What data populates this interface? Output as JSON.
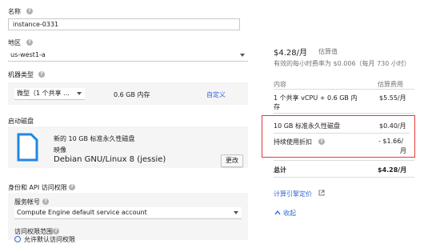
{
  "form": {
    "name_label": "名称",
    "name_value": "instance-0331",
    "zone_label": "地区",
    "zone_value": "us-west1-a",
    "machine_type_label": "机器类型",
    "machine_type_value": "微型（1 个共享 ...",
    "memory_text": "0.6 GB 内存",
    "customize_link": "自定义",
    "boot_disk_label": "启动磁盘",
    "boot_disk_title": "新的 10 GB 标准永久性磁盘",
    "boot_disk_image_label": "映像",
    "boot_disk_image": "Debian GNU/Linux 8 (jessie)",
    "change_button": "更改",
    "identity_label": "身份和 API 访问权限",
    "service_account_label": "服务帐号",
    "service_account_value": "Compute Engine default service account",
    "access_scope_label": "访问权限范围",
    "access_scope_option": "允许默认访问权限"
  },
  "pricing": {
    "monthly": "$4.28/月",
    "estimate_tag": "估算值",
    "effective_rate": "有效的每小时费率为 $0.006（每月 730 小时）",
    "col_item": "内容",
    "col_cost": "估算费用",
    "rows": [
      {
        "item_line1": "1 个共享 vCPU + 0.6 GB 内",
        "item_line2": "存",
        "cost": "$5.55/月"
      },
      {
        "item_line1": "10 GB 标准永久性磁盘",
        "item_line2": "",
        "cost": "$0.40/月"
      },
      {
        "item_line1": "持续使用折扣",
        "item_line2": "",
        "cost_line1": "- $1.66/",
        "cost_line2": "月"
      }
    ],
    "total_label": "总计",
    "total_value": "$4.28/月",
    "calculator_link": "计算引擎定价",
    "collapse_link": "收起"
  },
  "colors": {
    "accent": "#3367d6",
    "highlight_border": "#e53935",
    "disk_icon": "#1e88e5"
  }
}
